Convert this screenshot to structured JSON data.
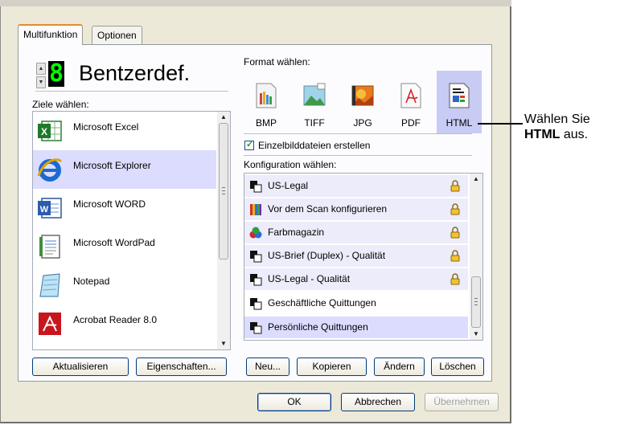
{
  "tabs": [
    "Multifunktion",
    "Optionen"
  ],
  "preset": {
    "digit": "8",
    "name": "Bentzerdef."
  },
  "destinations": {
    "label": "Ziele wählen:",
    "items": [
      {
        "label": "Microsoft Excel",
        "icon": "excel-icon"
      },
      {
        "label": "Microsoft Explorer",
        "icon": "internet-explorer-icon",
        "selected": true
      },
      {
        "label": "Microsoft WORD",
        "icon": "word-icon"
      },
      {
        "label": "Microsoft WordPad",
        "icon": "wordpad-icon"
      },
      {
        "label": "Notepad",
        "icon": "notepad-icon"
      },
      {
        "label": "Acrobat Reader 8.0",
        "icon": "acrobat-icon"
      }
    ]
  },
  "format": {
    "label": "Format wählen:",
    "items": [
      {
        "label": "BMP",
        "icon": "bmp-file-icon"
      },
      {
        "label": "TIFF",
        "icon": "tiff-file-icon"
      },
      {
        "label": "JPG",
        "icon": "jpg-file-icon"
      },
      {
        "label": "PDF",
        "icon": "pdf-file-icon"
      },
      {
        "label": "HTML",
        "icon": "html-file-icon",
        "selected": true
      }
    ],
    "single_files_checkbox": {
      "label": "Einzelbilddateien erstellen",
      "checked": true
    }
  },
  "configurations": {
    "label": "Konfiguration wählen:",
    "items": [
      {
        "label": "US-Legal",
        "locked": true
      },
      {
        "label": "Vor dem Scan konfigurieren",
        "locked": true
      },
      {
        "label": "Farbmagazin",
        "locked": true
      },
      {
        "label": "US-Brief (Duplex) - Qualität",
        "locked": true
      },
      {
        "label": "US-Legal - Qualität",
        "locked": true
      },
      {
        "label": "Geschäftliche Quittungen",
        "locked": false
      },
      {
        "label": "Persönliche Quittungen",
        "locked": false,
        "selected": true
      }
    ]
  },
  "buttons": {
    "refresh": "Aktualisieren",
    "properties": "Eigenschaften...",
    "new": "Neu...",
    "copy": "Kopieren",
    "edit": "Ändern",
    "delete": "Löschen",
    "ok": "OK",
    "cancel": "Abbrechen",
    "apply": "Übernehmen"
  },
  "callout": {
    "line1": "Wählen Sie",
    "line2_bold": "HTML",
    "line2_rest": " aus."
  },
  "colors": {
    "selection": "#dcdcff",
    "format_selection": "#c8ccf4",
    "led": "#00ff00"
  }
}
